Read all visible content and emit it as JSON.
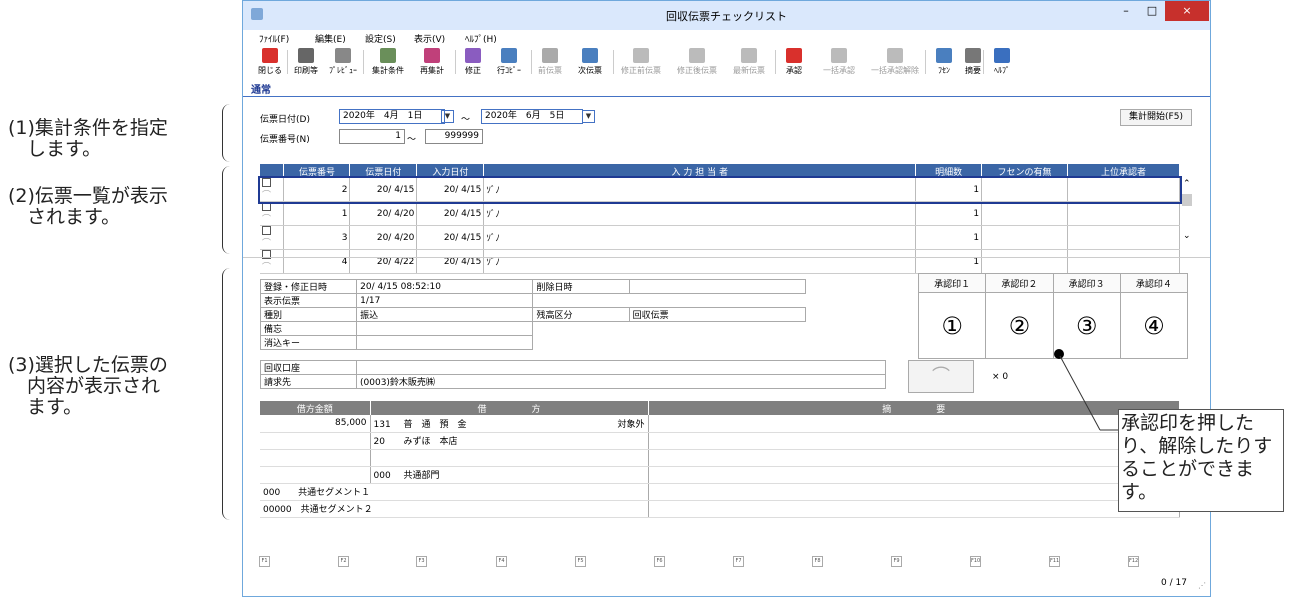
{
  "annotations": {
    "a1": "(1)集計条件を指定\n　します。",
    "a2": "(2)伝票一覧が表示\n　されます。",
    "a3": "(3)選択した伝票の\n　内容が表示され\n　ます。",
    "callout": "承認印を押したり、解除したりすることができます。"
  },
  "window": {
    "title": "回収伝票チェックリスト",
    "minimize": "–",
    "maximize": "□",
    "close": "×"
  },
  "menu": [
    "ﾌｧｲﾙ(F)",
    "編集(E)",
    "設定(S)",
    "表示(V)",
    "ﾍﾙﾌﾟ(H)"
  ],
  "toolbar": [
    {
      "label": "閉じる",
      "icon": "close-icon",
      "color": "#d9302c"
    },
    {
      "label": "印刷等",
      "icon": "printer-icon",
      "color": "#666666"
    },
    {
      "label": "ﾌﾟﾚﾋﾞｭｰ",
      "icon": "preview-icon",
      "color": "#888888"
    },
    {
      "label": "集計条件",
      "icon": "filter-icon",
      "color": "#6a8f5a"
    },
    {
      "label": "再集計",
      "icon": "recalc-icon",
      "color": "#c0407a"
    },
    {
      "label": "修正",
      "icon": "edit-icon",
      "color": "#8a5cc0"
    },
    {
      "label": "行ｺﾋﾟｰ",
      "icon": "copy-row-icon",
      "color": "#4a7fbf"
    },
    {
      "label": "前伝票",
      "icon": "prev-icon",
      "color": "#aaaaaa"
    },
    {
      "label": "次伝票",
      "icon": "next-icon",
      "color": "#4a7fbf"
    },
    {
      "label": "修正前伝票",
      "icon": "before-icon",
      "color": "#bbbbbb"
    },
    {
      "label": "修正後伝票",
      "icon": "after-icon",
      "color": "#bbbbbb"
    },
    {
      "label": "最新伝票",
      "icon": "latest-icon",
      "color": "#bbbbbb"
    },
    {
      "label": "承認",
      "icon": "approve-icon",
      "color": "#d9302c"
    },
    {
      "label": "一括承認",
      "icon": "bulk-approve-icon",
      "color": "#bbbbbb"
    },
    {
      "label": "一括承認解除",
      "icon": "bulk-unapprove-icon",
      "color": "#bbbbbb"
    },
    {
      "label": "ﾌｾﾝ",
      "icon": "sticky-icon",
      "color": "#4a7fbf"
    },
    {
      "label": "摘要",
      "icon": "memo-icon",
      "color": "#777777"
    },
    {
      "label": "ﾍﾙﾌﾟ",
      "icon": "help-icon",
      "color": "#3a6fbf"
    }
  ],
  "tab": "通常",
  "filter": {
    "date_label": "伝票日付(D)",
    "date_from": "2020年　4月　1日",
    "date_to": "2020年　6月　5日",
    "tilde": "〜",
    "no_label": "伝票番号(N)",
    "no_from": "1",
    "no_to": "999999",
    "start_button": "集計開始(F5)"
  },
  "list": {
    "headers": [
      "伝票番号",
      "伝票日付",
      "入力日付",
      "入 力 担 当 者",
      "明細数",
      "フセンの有無",
      "上位承認者"
    ],
    "rows": [
      {
        "no": "2",
        "date": "20/ 4/15",
        "input": "20/ 4/15",
        "user": "ｿﾞﾉ",
        "count": "1"
      },
      {
        "no": "1",
        "date": "20/ 4/20",
        "input": "20/ 4/15",
        "user": "ｿﾞﾉ",
        "count": "1"
      },
      {
        "no": "3",
        "date": "20/ 4/20",
        "input": "20/ 4/15",
        "user": "ｿﾞﾉ",
        "count": "1"
      },
      {
        "no": "4",
        "date": "20/ 4/22",
        "input": "20/ 4/15",
        "user": "ｿﾞﾉ",
        "count": "1"
      }
    ]
  },
  "detail": {
    "reg_label": "登録・修正日時",
    "reg_value": "20/ 4/15 08:52:10",
    "del_label": "削除日時",
    "del_value": "",
    "disp_label": "表示伝票",
    "disp_value": "1/17",
    "kind_label": "種別",
    "kind_value": "振込",
    "bal_label": "残高区分",
    "bal_value": "回収伝票",
    "memo_label": "備忘",
    "memo_value": "",
    "clear_label": "消込キー",
    "clear_value": "",
    "acct_label": "回収口座",
    "acct_value": "",
    "bill_label": "請求先",
    "bill_value": "(0003)鈴木販売㈱"
  },
  "approval": {
    "headers": [
      "承認印１",
      "承認印２",
      "承認印３",
      "承認印４"
    ],
    "stamps": [
      "①",
      "②",
      "③",
      "④"
    ],
    "clip_count": "× 0"
  },
  "entry": {
    "headers": [
      "借方金額",
      "借　　　　　方",
      "摘　　　　　要"
    ],
    "amount": "85,000",
    "lines": [
      {
        "code": "131",
        "name": "普　通　預　金",
        "tax": "対象外"
      },
      {
        "code": "20",
        "name": "みずほ　本店",
        "tax": ""
      },
      {
        "code": "",
        "name": "",
        "tax": ""
      },
      {
        "code": "000",
        "name": "共通部門",
        "tax": ""
      }
    ],
    "seg1": "000　　共通セグメント１",
    "seg2": "00000　共通セグメント２"
  },
  "fkeys": [
    "F1",
    "F2",
    "F3",
    "F4",
    "F5",
    "F6",
    "F7",
    "F8",
    "F9",
    "F10",
    "F11",
    "F12"
  ],
  "status": "0 / 17"
}
